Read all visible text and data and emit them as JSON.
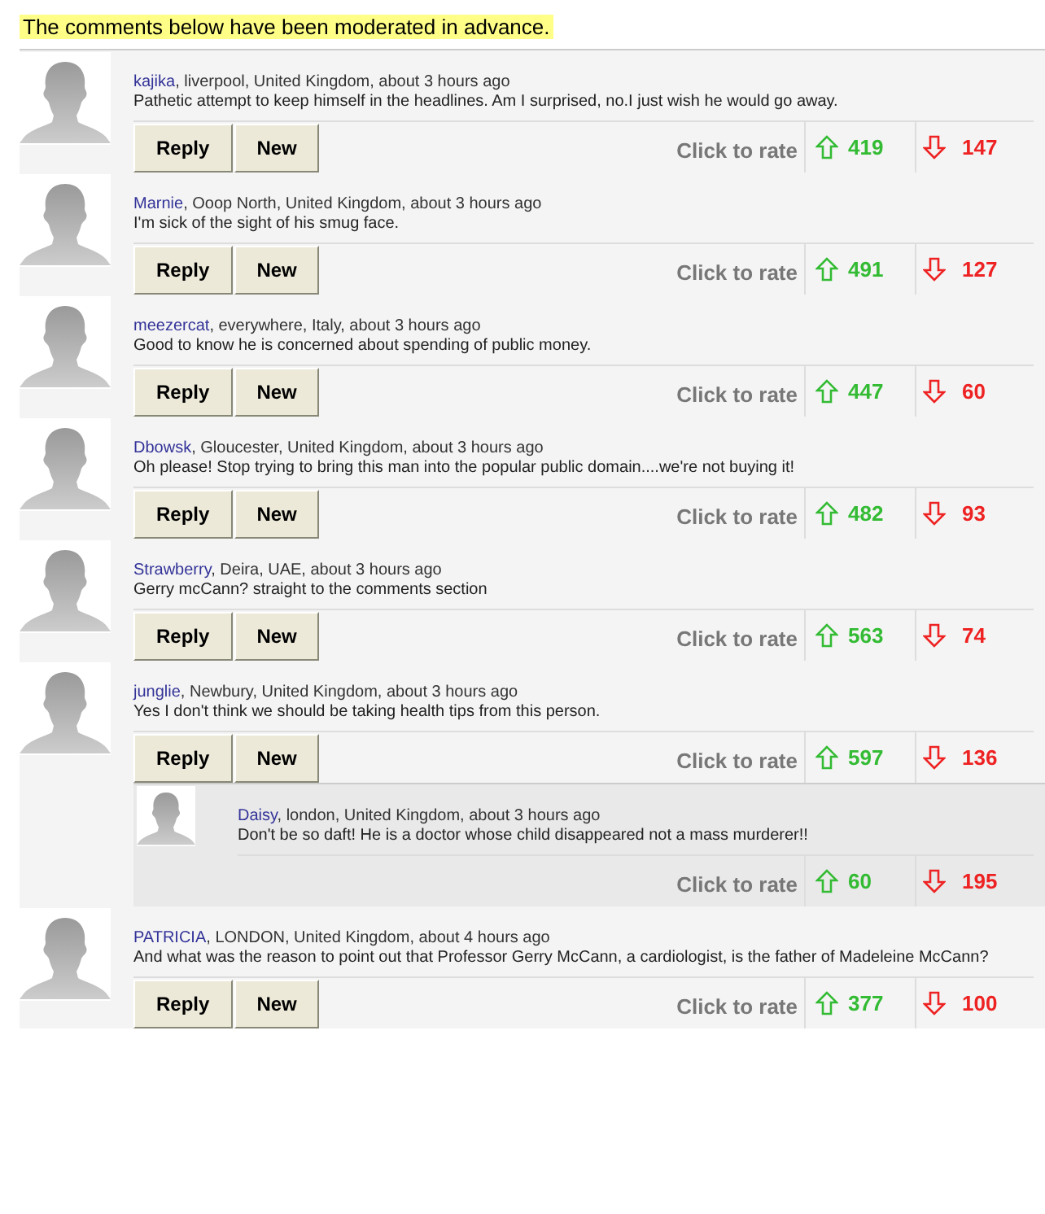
{
  "notice": "The comments below have been moderated in advance.",
  "comments": [
    {
      "author": "kajika",
      "meta": ", liverpool, United Kingdom, about 3 hours ago",
      "text": "Pathetic attempt to keep himself in the headlines. Am I surprised, no.I just wish he would go away.",
      "rate_label": "Click to rate",
      "up": "419",
      "down": "147",
      "buttons": [
        "Reply",
        "New"
      ]
    },
    {
      "author": "Marnie",
      "meta": ", Ooop North, United Kingdom, about 3 hours ago",
      "text": "I'm sick of the sight of his smug face.",
      "rate_label": "Click to rate",
      "up": "491",
      "down": "127",
      "buttons": [
        "Reply",
        "New"
      ]
    },
    {
      "author": "meezercat",
      "meta": ", everywhere, Italy, about 3 hours ago",
      "text": "Good to know he is concerned about spending of public money.",
      "rate_label": "Click to rate",
      "up": "447",
      "down": "60",
      "buttons": [
        "Reply",
        "New"
      ]
    },
    {
      "author": "Dbowsk",
      "meta": ", Gloucester, United Kingdom, about 3 hours ago",
      "text": "Oh please! Stop trying to bring this man into the popular public domain....we're not buying it!",
      "rate_label": "Click to rate",
      "up": "482",
      "down": "93",
      "buttons": [
        "Reply",
        "New"
      ]
    },
    {
      "author": "Strawberry",
      "meta": ", Deira, UAE, about 3 hours ago",
      "text": "Gerry mcCann? straight to the comments section",
      "rate_label": "Click to rate",
      "up": "563",
      "down": "74",
      "buttons": [
        "Reply",
        "New"
      ]
    },
    {
      "author": "junglie",
      "meta": ", Newbury, United Kingdom, about 3 hours ago",
      "text": "Yes I don't think we should be taking health tips from this person.",
      "rate_label": "Click to rate",
      "up": "597",
      "down": "136",
      "buttons": [
        "Reply",
        "New"
      ],
      "children": [
        {
          "author": "Daisy",
          "meta": ", london, United Kingdom, about 3 hours ago",
          "text": "Don't be so daft! He is a doctor whose child disappeared not a mass murderer!!",
          "rate_label": "Click to rate",
          "up": "60",
          "down": "195"
        }
      ]
    },
    {
      "author": "PATRICIA",
      "meta": ", LONDON, United Kingdom, about 4 hours ago",
      "text": "And what was the reason to point out that Professor Gerry McCann, a cardiologist, is the father of Madeleine McCann?",
      "rate_label": "Click to rate",
      "up": "377",
      "down": "100",
      "buttons": [
        "Reply",
        "New"
      ]
    }
  ]
}
